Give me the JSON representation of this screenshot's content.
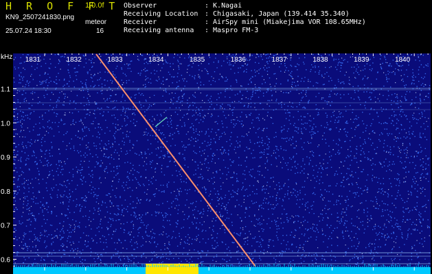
{
  "header": {
    "app_title": "H R O F F T",
    "version": "1.0.0f",
    "filename": "KN9_2507241830.png",
    "mode": "meteor",
    "datetime": "25.07.24 18:30",
    "count": "16"
  },
  "info": [
    {
      "label": "Observer",
      "value": ": K.Nagai"
    },
    {
      "label": "Receiving Location",
      "value": ": Chigasaki, Japan (139.414 35.340)"
    },
    {
      "label": "Receiver",
      "value": ": AirSpy mini (Miakejima VOR 108.65MHz)"
    },
    {
      "label": "Receiving antenna",
      "value": ": Maspro FM-3"
    }
  ],
  "axes": {
    "y_unit": "kHz",
    "y_ticks": [
      "1.1",
      "1.0",
      "0.9",
      "0.8",
      "0.7",
      "0.6"
    ],
    "x_ticks": [
      "1831",
      "1832",
      "1833",
      "1834",
      "1835",
      "1836",
      "1837",
      "1838",
      "1839",
      "1840"
    ]
  },
  "colors": {
    "background": "#000000",
    "spectrogram_base": "#0a0c7a",
    "noise": "#3c78ff",
    "signal": "#ffffff",
    "meteor_trace": "#ff5a3c",
    "baseline_bar": "#00c8ff",
    "activity_bar": "#ffe600",
    "title_yellow": "#d8e000"
  }
}
